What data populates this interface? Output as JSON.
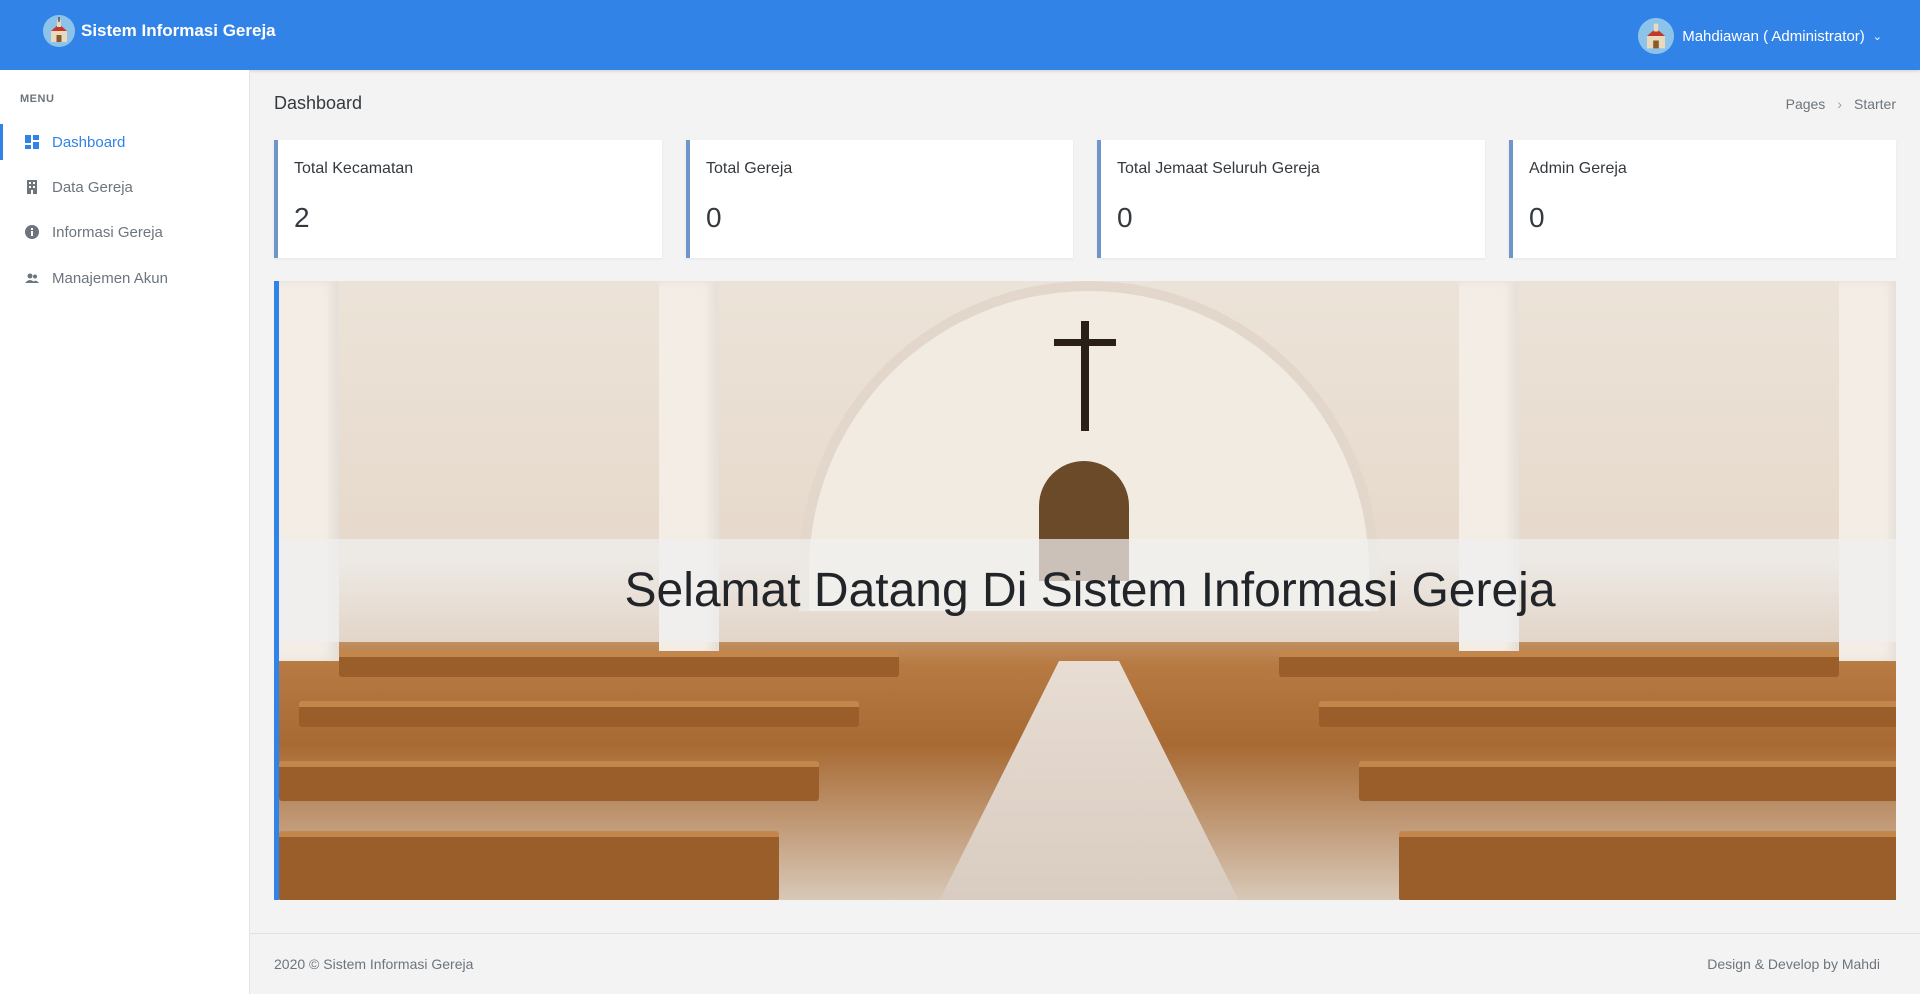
{
  "header": {
    "brand": "Sistem Informasi Gereja",
    "user_name": "Mahdiawan ( Administrator)"
  },
  "sidebar": {
    "menu_title": "MENU",
    "items": [
      {
        "label": "Dashboard",
        "icon": "dashboard-icon",
        "active": true
      },
      {
        "label": "Data Gereja",
        "icon": "building-icon",
        "active": false
      },
      {
        "label": "Informasi Gereja",
        "icon": "info-icon",
        "active": false
      },
      {
        "label": "Manajemen Akun",
        "icon": "users-icon",
        "active": false
      }
    ]
  },
  "page": {
    "title": "Dashboard",
    "breadcrumb": [
      "Pages",
      "Starter"
    ]
  },
  "cards": [
    {
      "label": "Total Kecamatan",
      "value": "2"
    },
    {
      "label": "Total Gereja",
      "value": "0"
    },
    {
      "label": "Total Jemaat Seluruh Gereja",
      "value": "0"
    },
    {
      "label": "Admin Gereja",
      "value": "0"
    }
  ],
  "hero": {
    "welcome": "Selamat Datang Di Sistem Informasi Gereja"
  },
  "footer": {
    "left": "2020 © Sistem Informasi Gereja",
    "right": "Design & Develop by Mahdi"
  },
  "colors": {
    "primary": "#3283e8",
    "card_border": "#6f95c9"
  }
}
